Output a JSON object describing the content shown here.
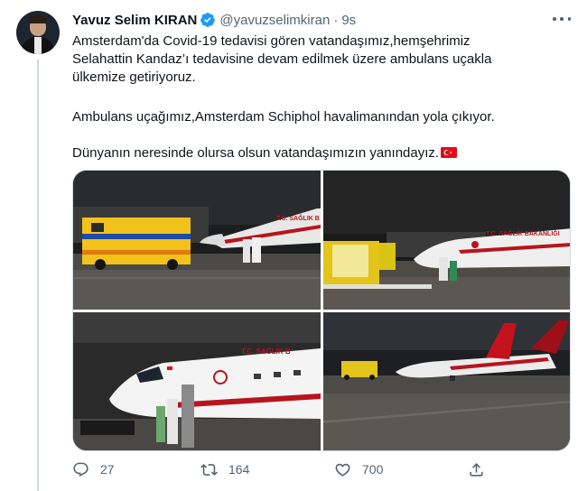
{
  "author": {
    "display_name": "Yavuz Selim KIRAN",
    "handle": "@yavuzselimkiran",
    "separator": "·",
    "timestamp": "9s",
    "verified_icon": "verified-badge-icon"
  },
  "tweet": {
    "paragraph1": "Amsterdam'da Covid-19 tedavisi gören vatandaşımız,hemşehrimiz\nSelahattin Kandaz’ı tedavisine devam edilmek üzere ambulans uçakla\nülkemize getiriyoruz.",
    "paragraph2": "Ambulans uçağımız,Amsterdam Schiphol havalimanından yola çıkıyor.",
    "paragraph3": "Dünyanın neresinde olursa olsun vatandaşımızın yanındayız.",
    "flag_emoji": "turkey-flag-icon"
  },
  "media": {
    "photos": [
      {
        "id": "photo-1",
        "aircraft_text": "T.C. SAĞLIK B"
      },
      {
        "id": "photo-2",
        "aircraft_text": "T.C. SAĞLIK BAKANLIĞI"
      },
      {
        "id": "photo-3",
        "aircraft_text": "T.C. SAĞLIK B"
      },
      {
        "id": "photo-4",
        "aircraft_text": ""
      }
    ]
  },
  "actions": {
    "replies": "27",
    "retweets": "164",
    "likes": "700",
    "icons": [
      "reply-icon",
      "retweet-icon",
      "like-icon",
      "share-icon"
    ]
  },
  "colors": {
    "text_primary": "#0f1419",
    "text_secondary": "#536471",
    "verified_blue": "#1d9bf0",
    "border": "#cfd9de",
    "flag_red": "#e30a17"
  }
}
